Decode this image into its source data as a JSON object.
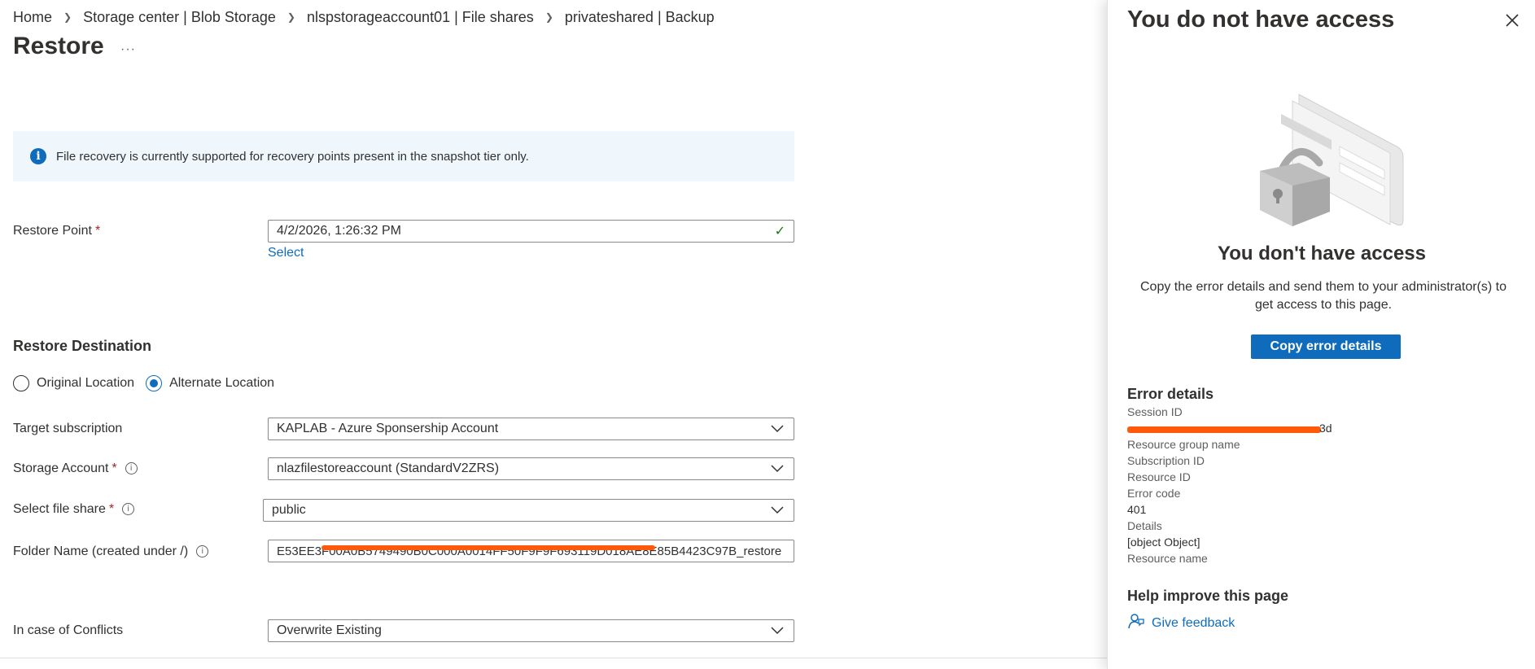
{
  "breadcrumb": [
    "Home",
    "Storage center | Blob Storage",
    "nlspstorageaccount01 | File shares",
    "privateshared | Backup"
  ],
  "page_title": "Restore",
  "more_label": "···",
  "info_banner": {
    "text": "File recovery is currently supported  for recovery points present in the snapshot tier only."
  },
  "restore_point": {
    "label": "Restore Point",
    "value": "4/2/2026, 1:26:32 PM",
    "select_link": "Select"
  },
  "restore_destination": {
    "heading": "Restore Destination",
    "options": [
      "Original Location",
      "Alternate Location"
    ],
    "selected": "Alternate Location"
  },
  "form": {
    "target_subscription": {
      "label": "Target subscription",
      "value": "KAPLAB - Azure Sponsership Account"
    },
    "storage_account": {
      "label": "Storage Account",
      "value": "nlazfilestoreaccount (StandardV2ZRS)"
    },
    "file_share": {
      "label": "Select file share",
      "value": "public"
    },
    "folder_name": {
      "label": "Folder Name (created under /)",
      "value": "E53EE3F00A0B5749490B0C000A0014FF50F9F9F693119D018AE8E85B4423C97B_restore"
    },
    "conflicts": {
      "label": "In case of Conflicts",
      "value": "Overwrite Existing"
    }
  },
  "panel": {
    "title": "You do not have access",
    "no_access_title": "You don't have access",
    "description": "Copy the error details and send them to your administrator(s) to get access to this page.",
    "copy_button": "Copy error details",
    "error_heading": "Error details",
    "session_id_label": "Session ID",
    "session_id_tail": "3d",
    "resource_group_label": "Resource group name",
    "subscription_label": "Subscription ID",
    "resource_id_label": "Resource ID",
    "error_code_label": "Error code",
    "error_code": "401",
    "details_label": "Details",
    "details": "[object Object]",
    "resource_name_label": "Resource name",
    "help_heading": "Help improve this page",
    "feedback_link": "Give feedback"
  },
  "colors": {
    "accent": "#0f6cbd",
    "redaction": "#ff5a0a",
    "banner_bg": "#eff6fc",
    "success": "#107c10",
    "required": "#a4262c"
  }
}
